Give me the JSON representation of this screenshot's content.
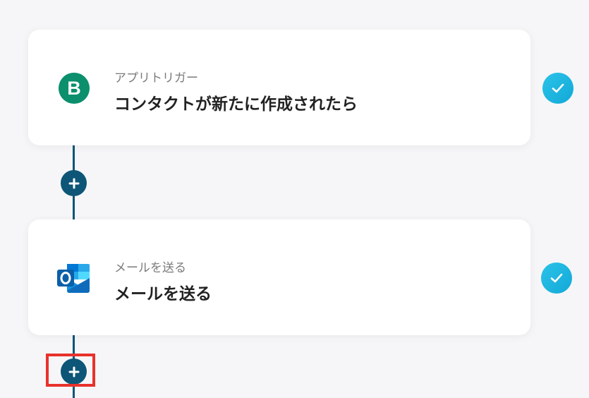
{
  "steps": [
    {
      "label": "アプリトリガー",
      "title": "コンタクトが新たに作成されたら",
      "icon": "brevo-logo-icon",
      "status": "completed"
    },
    {
      "label": "メールを送る",
      "title": "メールを送る",
      "icon": "outlook-logo-icon",
      "status": "completed"
    }
  ],
  "colors": {
    "connector": "#0d5677",
    "check": "#1fb6e0",
    "highlight": "#e8322b",
    "brevo": "#0b8f6c",
    "outlook": "#0f6cbd"
  }
}
